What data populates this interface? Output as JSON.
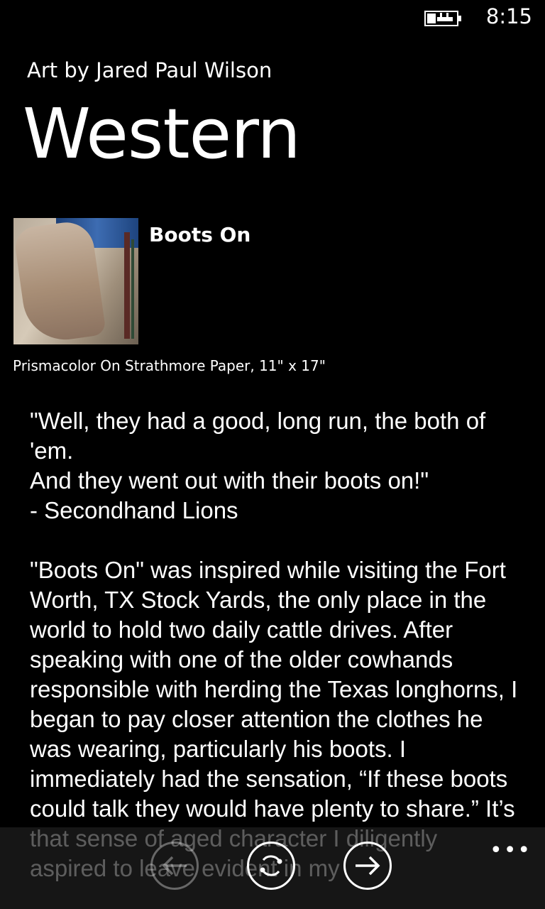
{
  "status_bar": {
    "time": "8:15",
    "battery_icon": "battery-charging-icon"
  },
  "header": {
    "app_title": "Art by Jared Paul Wilson",
    "page_title": "Western"
  },
  "artwork": {
    "name": "Boots On",
    "medium": "Prismacolor On Strathmore Paper, 11\" x 17\"",
    "thumbnail_icon": "artwork-thumbnail"
  },
  "description": {
    "quote_lines": [
      "\"Well, they had a good, long run, the both of 'em.",
      "And they went out with their boots on!\"",
      "- Secondhand Lions"
    ],
    "body": "\"Boots On\" was inspired while visiting the Fort Worth, TX Stock Yards, the only place in the world to hold two daily cattle drives. After speaking with one of the older cowhands responsible with herding the Texas longhorns, I began to pay closer attention the clothes he was wearing, particularly his boots. I immediately had the sensation, “If these boots could talk they would have plenty to share.” It’s that sense of aged character I diligently aspired to leave evident in my"
  },
  "app_bar": {
    "back_icon": "back-arrow-icon",
    "sync_icon": "refresh-icon",
    "next_icon": "forward-arrow-icon",
    "more_label": "•••",
    "back_enabled": false
  }
}
